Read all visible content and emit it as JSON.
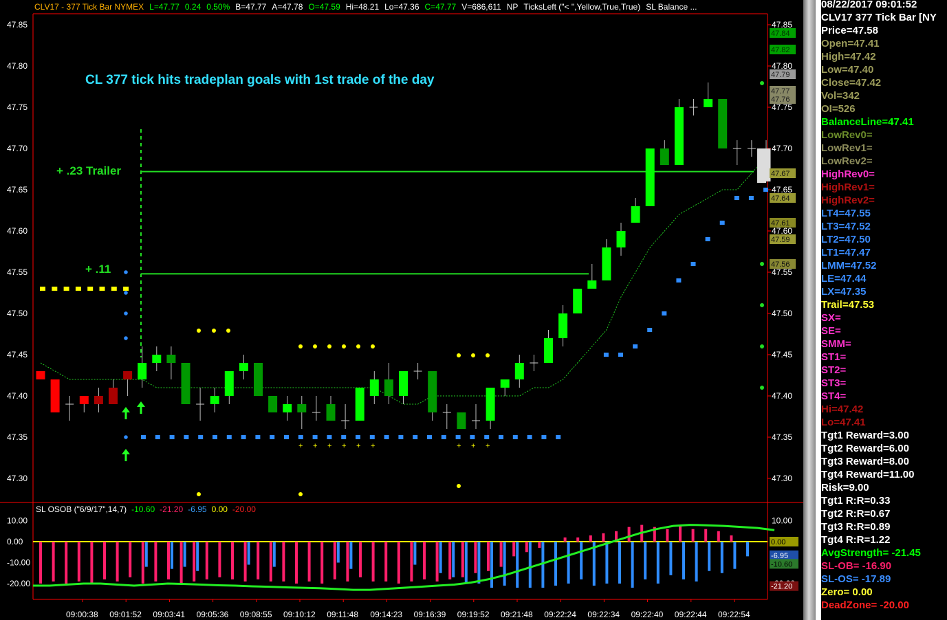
{
  "header": [
    {
      "text": "CLV17 - 377 Tick Bar  NYMEX",
      "color": "#ffb000"
    },
    {
      "text": "L=47.77",
      "color": "#00ff00"
    },
    {
      "text": "0.24",
      "color": "#00ff00"
    },
    {
      "text": "0.50%",
      "color": "#00ff00"
    },
    {
      "text": "B=47.77",
      "color": "#ffffff"
    },
    {
      "text": "A=47.78",
      "color": "#ffffff"
    },
    {
      "text": "O=47.59",
      "color": "#00ff00"
    },
    {
      "text": "Hi=48.21",
      "color": "#ffffff"
    },
    {
      "text": "Lo=47.36",
      "color": "#ffffff"
    },
    {
      "text": "C=47.77",
      "color": "#00ff00"
    },
    {
      "text": "V=686,611",
      "color": "#ffffff"
    },
    {
      "text": "NP",
      "color": "#ffffff"
    },
    {
      "text": "TicksLeft (\"< \",Yellow,True,True)",
      "color": "#ffffff"
    },
    {
      "text": "SL  Balance ...",
      "color": "#ffffff"
    }
  ],
  "annotations": {
    "title": "CL 377 tick hits tradeplan goals with 1st trade of the day",
    "trailer": "+ .23 Trailer",
    "plus11": "+ .11"
  },
  "indicator_header": [
    {
      "text": "SL  OSOB (\"6/9/17\",14,7)",
      "color": "#ffffff"
    },
    {
      "text": "-10.60",
      "color": "#00ff00"
    },
    {
      "text": "-21.20",
      "color": "#ff2266"
    },
    {
      "text": "-6.95",
      "color": "#3aa0ff"
    },
    {
      "text": "0.00",
      "color": "#ffff00"
    },
    {
      "text": "-20.00",
      "color": "#ff2020"
    }
  ],
  "colors": {
    "up": "#00ff00",
    "down": "#009900",
    "red": "#ff0000",
    "darkred": "#aa0000",
    "blue": "#2f8cff",
    "yellow": "#ffff00",
    "grid": "#ff0000",
    "pink": "#ff1f6a"
  },
  "chart_data": {
    "type": "candlestick",
    "price_axis": {
      "min": 47.25,
      "max": 47.88,
      "ticks": [
        "47.30",
        "47.35",
        "47.40",
        "47.45",
        "47.50",
        "47.55",
        "47.60",
        "47.65",
        "47.70",
        "47.75",
        "47.80",
        "47.85"
      ]
    },
    "time_labels": [
      "09:00:38",
      "09:01:52",
      "09:03:41",
      "09:05:36",
      "09:08:55",
      "09:10:12",
      "09:11:48",
      "09:14:23",
      "09:16:39",
      "09:19:52",
      "09:21:48",
      "09:22:24",
      "09:22:34",
      "09:22:40",
      "09:22:44",
      "09:22:54"
    ],
    "candles": [
      {
        "o": 47.43,
        "h": 47.43,
        "l": 47.42,
        "c": 47.42,
        "col": "red"
      },
      {
        "o": 47.42,
        "h": 47.42,
        "l": 47.38,
        "c": 47.38,
        "col": "red"
      },
      {
        "o": 47.39,
        "h": 47.4,
        "l": 47.37,
        "c": 47.39,
        "col": "doji"
      },
      {
        "o": 47.4,
        "h": 47.4,
        "l": 47.38,
        "c": 47.39,
        "col": "red"
      },
      {
        "o": 47.4,
        "h": 47.41,
        "l": 47.38,
        "c": 47.39,
        "col": "darkred"
      },
      {
        "o": 47.41,
        "h": 47.42,
        "l": 47.39,
        "c": 47.39,
        "col": "darkred"
      },
      {
        "o": 47.42,
        "h": 47.43,
        "l": 47.4,
        "c": 47.43,
        "col": "darkred"
      },
      {
        "o": 47.42,
        "h": 47.46,
        "l": 47.41,
        "c": 47.44,
        "col": "up"
      },
      {
        "o": 47.44,
        "h": 47.46,
        "l": 47.43,
        "c": 47.45,
        "col": "up"
      },
      {
        "o": 47.45,
        "h": 47.46,
        "l": 47.42,
        "c": 47.44,
        "col": "down"
      },
      {
        "o": 47.44,
        "h": 47.44,
        "l": 47.39,
        "c": 47.39,
        "col": "down"
      },
      {
        "o": 47.39,
        "h": 47.41,
        "l": 47.37,
        "c": 47.39,
        "col": "doji"
      },
      {
        "o": 47.39,
        "h": 47.41,
        "l": 47.38,
        "c": 47.4,
        "col": "up"
      },
      {
        "o": 47.4,
        "h": 47.43,
        "l": 47.39,
        "c": 47.43,
        "col": "up"
      },
      {
        "o": 47.43,
        "h": 47.45,
        "l": 47.42,
        "c": 47.44,
        "col": "up"
      },
      {
        "o": 47.44,
        "h": 47.44,
        "l": 47.4,
        "c": 47.4,
        "col": "down"
      },
      {
        "o": 47.4,
        "h": 47.4,
        "l": 47.38,
        "c": 47.38,
        "col": "down"
      },
      {
        "o": 47.38,
        "h": 47.4,
        "l": 47.37,
        "c": 47.39,
        "col": "up"
      },
      {
        "o": 47.39,
        "h": 47.4,
        "l": 47.36,
        "c": 47.38,
        "col": "down"
      },
      {
        "o": 47.38,
        "h": 47.4,
        "l": 47.37,
        "c": 47.38,
        "col": "doji"
      },
      {
        "o": 47.39,
        "h": 47.4,
        "l": 47.37,
        "c": 47.37,
        "col": "down"
      },
      {
        "o": 47.37,
        "h": 47.39,
        "l": 47.36,
        "c": 47.37,
        "col": "doji"
      },
      {
        "o": 47.37,
        "h": 47.41,
        "l": 47.37,
        "c": 47.41,
        "col": "up"
      },
      {
        "o": 47.4,
        "h": 47.43,
        "l": 47.39,
        "c": 47.42,
        "col": "up"
      },
      {
        "o": 47.42,
        "h": 47.44,
        "l": 47.39,
        "c": 47.4,
        "col": "down"
      },
      {
        "o": 47.4,
        "h": 47.43,
        "l": 47.39,
        "c": 47.43,
        "col": "up"
      },
      {
        "o": 47.43,
        "h": 47.44,
        "l": 47.42,
        "c": 47.43,
        "col": "doji"
      },
      {
        "o": 47.43,
        "h": 47.43,
        "l": 47.37,
        "c": 47.38,
        "col": "down"
      },
      {
        "o": 47.38,
        "h": 47.39,
        "l": 47.36,
        "c": 47.38,
        "col": "doji"
      },
      {
        "o": 47.38,
        "h": 47.38,
        "l": 47.36,
        "c": 47.36,
        "col": "down"
      },
      {
        "o": 47.37,
        "h": 47.39,
        "l": 47.36,
        "c": 47.37,
        "col": "doji"
      },
      {
        "o": 47.37,
        "h": 47.41,
        "l": 47.36,
        "c": 47.41,
        "col": "up"
      },
      {
        "o": 47.41,
        "h": 47.42,
        "l": 47.4,
        "c": 47.42,
        "col": "up"
      },
      {
        "o": 47.42,
        "h": 47.45,
        "l": 47.41,
        "c": 47.44,
        "col": "up"
      },
      {
        "o": 47.44,
        "h": 47.45,
        "l": 47.43,
        "c": 47.44,
        "col": "doji"
      },
      {
        "o": 47.44,
        "h": 47.48,
        "l": 47.44,
        "c": 47.47,
        "col": "up"
      },
      {
        "o": 47.47,
        "h": 47.51,
        "l": 47.46,
        "c": 47.5,
        "col": "up"
      },
      {
        "o": 47.5,
        "h": 47.53,
        "l": 47.5,
        "c": 47.53,
        "col": "up"
      },
      {
        "o": 47.53,
        "h": 47.56,
        "l": 47.53,
        "c": 47.54,
        "col": "up"
      },
      {
        "o": 47.54,
        "h": 47.59,
        "l": 47.54,
        "c": 47.58,
        "col": "up"
      },
      {
        "o": 47.58,
        "h": 47.61,
        "l": 47.57,
        "c": 47.6,
        "col": "up"
      },
      {
        "o": 47.61,
        "h": 47.64,
        "l": 47.61,
        "c": 47.63,
        "col": "up"
      },
      {
        "o": 47.63,
        "h": 47.7,
        "l": 47.63,
        "c": 47.7,
        "col": "up"
      },
      {
        "o": 47.7,
        "h": 47.71,
        "l": 47.68,
        "c": 47.68,
        "col": "down"
      },
      {
        "o": 47.68,
        "h": 47.76,
        "l": 47.68,
        "c": 47.75,
        "col": "up"
      },
      {
        "o": 47.75,
        "h": 47.76,
        "l": 47.74,
        "c": 47.75,
        "col": "doji"
      },
      {
        "o": 47.75,
        "h": 47.78,
        "l": 47.75,
        "c": 47.76,
        "col": "up"
      },
      {
        "o": 47.76,
        "h": 47.76,
        "l": 47.7,
        "c": 47.7,
        "col": "down"
      },
      {
        "o": 47.7,
        "h": 47.71,
        "l": 47.68,
        "c": 47.7,
        "col": "doji"
      },
      {
        "o": 47.7,
        "h": 47.71,
        "l": 47.69,
        "c": 47.7,
        "col": "doji"
      },
      {
        "o": 47.7,
        "h": 47.71,
        "l": 47.66,
        "c": 47.66,
        "col": "white"
      }
    ],
    "balance_line": [
      47.44,
      47.43,
      47.42,
      47.42,
      47.42,
      47.42,
      47.42,
      47.42,
      47.41,
      47.41,
      47.41,
      47.41,
      47.41,
      47.41,
      47.41,
      47.41,
      47.41,
      47.41,
      47.41,
      47.41,
      47.41,
      47.41,
      47.41,
      47.41,
      47.4,
      47.39,
      47.39,
      47.4,
      47.4,
      47.4,
      47.4,
      47.4,
      47.4,
      47.4,
      47.41,
      47.41,
      47.42,
      47.44,
      47.46,
      47.48,
      47.52,
      47.55,
      47.58,
      47.6,
      47.62,
      47.63,
      47.64,
      47.65,
      47.65,
      47.67,
      47.69
    ],
    "stop_line": {
      "price": 47.35,
      "from": 6,
      "to": 37
    },
    "upper_stops": [
      {
        "i": 39,
        "p": 47.45
      },
      {
        "i": 40,
        "p": 47.45
      },
      {
        "i": 41,
        "p": 47.46
      },
      {
        "i": 42,
        "p": 47.48
      },
      {
        "i": 43,
        "p": 47.5
      },
      {
        "i": 44,
        "p": 47.54
      },
      {
        "i": 45,
        "p": 47.56
      },
      {
        "i": 46,
        "p": 47.59
      },
      {
        "i": 47,
        "p": 47.61
      },
      {
        "i": 48,
        "p": 47.64
      },
      {
        "i": 49,
        "p": 47.64
      },
      {
        "i": 50,
        "p": 47.65
      },
      {
        "i": 51,
        "p": 47.67
      }
    ],
    "trail_yellow": {
      "price": 47.53,
      "from": 0,
      "to": 6
    },
    "target_lines": [
      {
        "price": 47.672,
        "from": 7,
        "to": 51
      },
      {
        "price": 47.548,
        "from": 7,
        "to": 38
      }
    ],
    "right_markers": [
      {
        "label": "47.84",
        "p": 47.84,
        "bg": "#00a000",
        "fg": "#003300"
      },
      {
        "label": "47.82",
        "p": 47.82,
        "bg": "#00a000",
        "fg": "#003300"
      },
      {
        "label": "47.79",
        "p": 47.79,
        "bg": "#999999",
        "fg": "#222222"
      },
      {
        "label": "47.77",
        "p": 47.77,
        "bg": "#888866",
        "fg": "#222222"
      },
      {
        "label": "47.76",
        "p": 47.76,
        "bg": "#888866",
        "fg": "#222222"
      },
      {
        "label": "47.67",
        "p": 47.67,
        "bg": "#999933",
        "fg": "#111111"
      },
      {
        "label": "47.64",
        "p": 47.64,
        "bg": "#999933",
        "fg": "#111111"
      },
      {
        "label": "47.61",
        "p": 47.61,
        "bg": "#888822",
        "fg": "#111111"
      },
      {
        "label": "47.59",
        "p": 47.59,
        "bg": "#999933",
        "fg": "#111111"
      },
      {
        "label": "47.56",
        "p": 47.56,
        "bg": "#888833",
        "fg": "#111111"
      }
    ],
    "osob": {
      "axis": {
        "min": -25,
        "max": 13,
        "ticks": [
          "10.00",
          "0.00",
          "-10.00",
          "-20.00"
        ]
      },
      "pink": [
        -20,
        -19,
        -20,
        -19,
        -20,
        -18,
        -19,
        -17,
        -20,
        -19,
        -18,
        -20,
        -19,
        -18,
        -17,
        -18,
        -19,
        -18,
        -19,
        -19,
        -20,
        -19,
        -20,
        -18,
        -19,
        -17,
        -19,
        -19,
        -20,
        -19,
        -18,
        -19,
        -18,
        -17,
        -15,
        -14,
        -12,
        -7,
        -5,
        -3,
        0,
        2,
        2,
        3,
        4,
        5,
        7,
        8,
        7,
        6,
        8,
        6,
        6,
        5,
        3,
        0
      ],
      "blue": [
        0,
        0,
        0,
        0,
        0,
        0,
        0,
        0,
        -12,
        0,
        -13,
        -12,
        -14,
        0,
        0,
        0,
        -11,
        0,
        -12,
        0,
        0,
        0,
        0,
        -10,
        -13,
        0,
        0,
        0,
        0,
        -11,
        0,
        -15,
        -17,
        -20,
        -20,
        -22,
        -21,
        -22,
        -22,
        -22,
        -21,
        -20,
        -18,
        -21,
        -20,
        -20,
        -22,
        -18,
        -20,
        -16,
        -18,
        -19,
        -14,
        -15,
        -13,
        -7
      ],
      "osc": [
        -21,
        -21,
        -20.5,
        -20,
        -20,
        -20.5,
        -21,
        -20.5,
        -20,
        -20.2,
        -20.5,
        -20.8,
        -21,
        -21.3,
        -21.5,
        -21.8,
        -22,
        -22.2,
        -22.6,
        -23,
        -23,
        -22.5,
        -22,
        -21.5,
        -21,
        -20.5,
        -19.5,
        -18,
        -16,
        -13.5,
        -11,
        -8.5,
        -6,
        -3.5,
        -1,
        1.5,
        4,
        6,
        7.5,
        8,
        7.8,
        7.5,
        7,
        6.5,
        5.5
      ],
      "right_markers": [
        {
          "label": "0.00",
          "v": 0,
          "bg": "#999900",
          "fg": "#000000"
        },
        {
          "label": "-6.95",
          "v": -6.5,
          "bg": "#1f4fa8",
          "fg": "#ffffff"
        },
        {
          "label": "-10.60",
          "v": -10.6,
          "bg": "#2b7a2b",
          "fg": "#000000"
        },
        {
          "label": "-21.20",
          "v": -21.2,
          "bg": "#7a1111",
          "fg": "#ffffff"
        }
      ]
    }
  },
  "panel": [
    {
      "text": "08/22/2017 09:01:52",
      "color": "#ffffff"
    },
    {
      "text": "CLV17 377 Tick Bar [NY",
      "color": "#ffffff"
    },
    {
      "text": "Price=47.58",
      "color": "#ffffff"
    },
    {
      "text": "Open=47.41",
      "color": "#9b9b5a"
    },
    {
      "text": "High=47.42",
      "color": "#9b9b5a"
    },
    {
      "text": "Low=47.40",
      "color": "#9b9b5a"
    },
    {
      "text": "Close=47.42",
      "color": "#9b9b5a"
    },
    {
      "text": "Vol=342",
      "color": "#9b9b5a"
    },
    {
      "text": "OI=526",
      "color": "#9b9b5a"
    },
    {
      "text": "BalanceLine=47.41",
      "color": "#00ff00"
    },
    {
      "text": "LowRev0=",
      "color": "#6b8c2a"
    },
    {
      "text": "LowRev1=",
      "color": "#8b8b5a"
    },
    {
      "text": "LowRev2=",
      "color": "#8b8b5a"
    },
    {
      "text": "HighRev0=",
      "color": "#ff33cc"
    },
    {
      "text": "HighRev1=",
      "color": "#b01010"
    },
    {
      "text": "HighRev2=",
      "color": "#b01010"
    },
    {
      "text": "LT4=47.55",
      "color": "#3a8cff"
    },
    {
      "text": "LT3=47.52",
      "color": "#3a8cff"
    },
    {
      "text": "LT2=47.50",
      "color": "#3a8cff"
    },
    {
      "text": "LT1=47.47",
      "color": "#3a8cff"
    },
    {
      "text": "LMM=47.52",
      "color": "#3a8cff"
    },
    {
      "text": "LE=47.44",
      "color": "#3a8cff"
    },
    {
      "text": "LX=47.35",
      "color": "#3a8cff"
    },
    {
      "text": "Trail=47.53",
      "color": "#ffff33"
    },
    {
      "text": "SX=",
      "color": "#ff33cc"
    },
    {
      "text": "SE=",
      "color": "#ff33cc"
    },
    {
      "text": "SMM=",
      "color": "#ff33cc"
    },
    {
      "text": "ST1=",
      "color": "#ff33cc"
    },
    {
      "text": "ST2=",
      "color": "#ff33cc"
    },
    {
      "text": "ST3=",
      "color": "#ff33cc"
    },
    {
      "text": "ST4=",
      "color": "#ff33cc"
    },
    {
      "text": "Hi=47.42",
      "color": "#b01010"
    },
    {
      "text": "Lo=47.41",
      "color": "#b01010"
    },
    {
      "text": "Tgt1 Reward=3.00",
      "color": "#ffffff"
    },
    {
      "text": "Tgt2 Reward=6.00",
      "color": "#ffffff"
    },
    {
      "text": "Tgt3 Reward=8.00",
      "color": "#ffffff"
    },
    {
      "text": "Tgt4 Reward=11.00",
      "color": "#ffffff"
    },
    {
      "text": "Risk=9.00",
      "color": "#ffffff"
    },
    {
      "text": "Tgt1 R:R=0.33",
      "color": "#ffffff"
    },
    {
      "text": "Tgt2 R:R=0.67",
      "color": "#ffffff"
    },
    {
      "text": "Tgt3 R:R=0.89",
      "color": "#ffffff"
    },
    {
      "text": "Tgt4 R:R=1.22",
      "color": "#ffffff"
    },
    {
      "text": "AvgStrength= -21.45",
      "color": "#00ff00"
    },
    {
      "text": "SL-OB= -16.90",
      "color": "#ff1f6a"
    },
    {
      "text": "SL-OS= -17.89",
      "color": "#3a8cff"
    },
    {
      "text": "Zero= 0.00",
      "color": "#ffff33"
    },
    {
      "text": "DeadZone= -20.00",
      "color": "#ff2020"
    }
  ]
}
